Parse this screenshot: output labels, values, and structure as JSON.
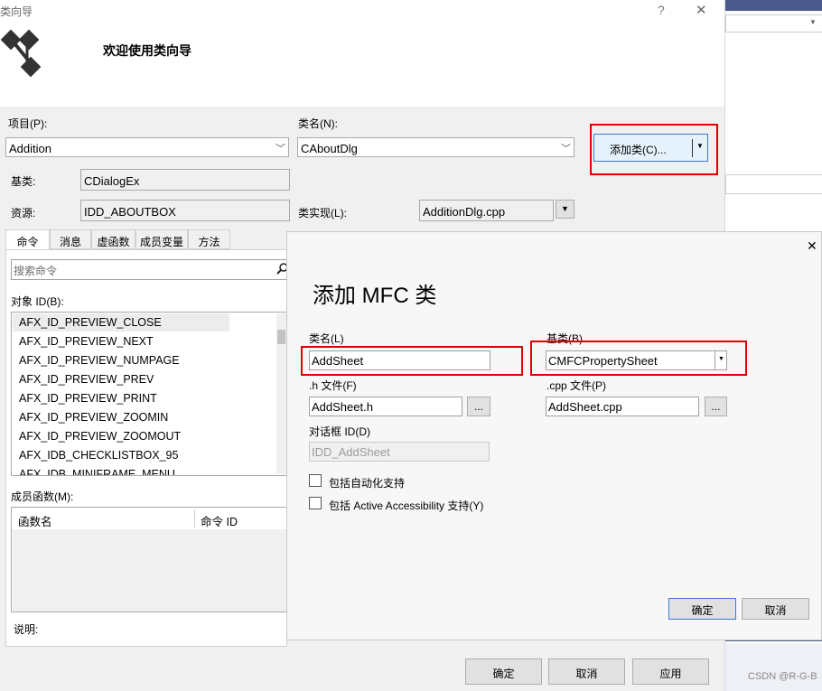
{
  "wizard": {
    "title": "类向导",
    "help_glyph": "?",
    "close_glyph": "✕",
    "welcome": "欢迎使用类向导",
    "project_label": "项目(P):",
    "project_value": "Addition",
    "classname_label": "类名(N):",
    "classname_value": "CAboutDlg",
    "add_class_button": "添加类(C)...",
    "base_label": "基类:",
    "base_value": "CDialogEx",
    "resource_label": "资源:",
    "resource_value": "IDD_ABOUTBOX",
    "impl_label": "类实现(L):",
    "impl_value": "AdditionDlg.cpp",
    "tabs": [
      "命令",
      "消息",
      "虚函数",
      "成员变量",
      "方法"
    ],
    "search_placeholder": "搜索命令",
    "object_id_label": "对象 ID(B):",
    "object_ids": [
      "AFX_ID_PREVIEW_CLOSE",
      "AFX_ID_PREVIEW_NEXT",
      "AFX_ID_PREVIEW_NUMPAGE",
      "AFX_ID_PREVIEW_PREV",
      "AFX_ID_PREVIEW_PRINT",
      "AFX_ID_PREVIEW_ZOOMIN",
      "AFX_ID_PREVIEW_ZOOMOUT",
      "AFX_IDB_CHECKLISTBOX_95",
      "AFX_IDB_MINIFRAME_MENU"
    ],
    "member_func_label": "成员函数(M):",
    "col_func_name": "函数名",
    "col_command_id": "命令 ID",
    "desc_label": "说明:",
    "ok": "确定",
    "cancel": "取消",
    "apply": "应用"
  },
  "dialog": {
    "close_glyph": "✕",
    "title": "添加 MFC 类",
    "classname_label": "类名(L)",
    "classname_value": "AddSheet",
    "base_label": "基类(B)",
    "base_value": "CMFCPropertySheet",
    "h_label": ".h 文件(F)",
    "h_value": "AddSheet.h",
    "cpp_label": ".cpp 文件(P)",
    "cpp_value": "AddSheet.cpp",
    "browse": "...",
    "dialog_id_label": "对话框 ID(D)",
    "dialog_id_value": "IDD_AddSheet",
    "check_automation": "包括自动化支持",
    "check_accessibility": "包括 Active Accessibility 支持(Y)",
    "ok": "确定",
    "cancel": "取消"
  },
  "watermark": "CSDN @R-G-B",
  "colors": {
    "highlight_red": "#e00000",
    "accent_blue": "#3c78d8"
  }
}
